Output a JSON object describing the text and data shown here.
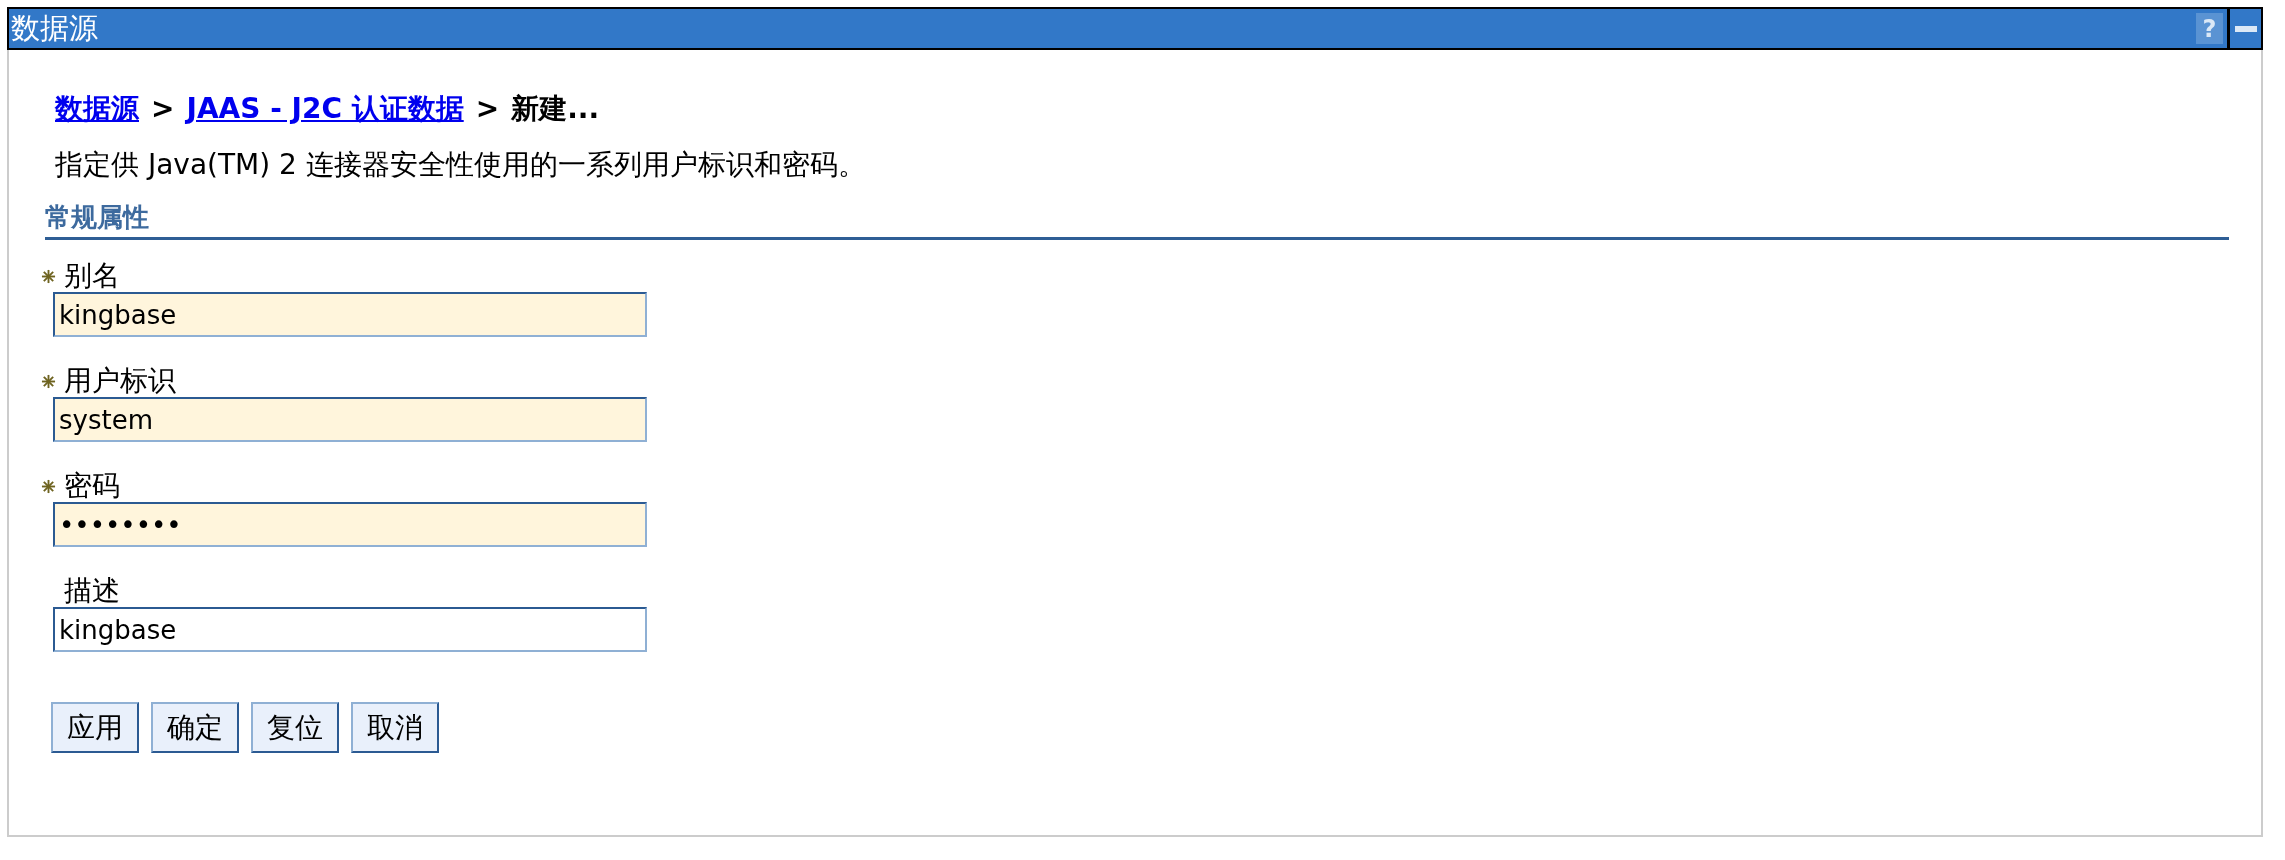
{
  "window": {
    "title": "数据源",
    "help": "?"
  },
  "breadcrumb": {
    "links": [
      "数据源",
      "JAAS  -  J2C 认证数据"
    ],
    "separator": ">",
    "current": "新建..."
  },
  "description": "指定供 Java(TM) 2 连接器安全性使用的一系列用户标识和密码。",
  "section": {
    "title": "常规属性"
  },
  "fields": [
    {
      "label": "别名",
      "value": "kingbase",
      "required": true
    },
    {
      "label": "用户标识",
      "value": "system",
      "required": true
    },
    {
      "label": "密码",
      "value": "••••••••",
      "required": true
    },
    {
      "label": "描述",
      "value": "kingbase",
      "required": false
    }
  ],
  "buttons": [
    "应用",
    "确定",
    "复位",
    "取消"
  ]
}
